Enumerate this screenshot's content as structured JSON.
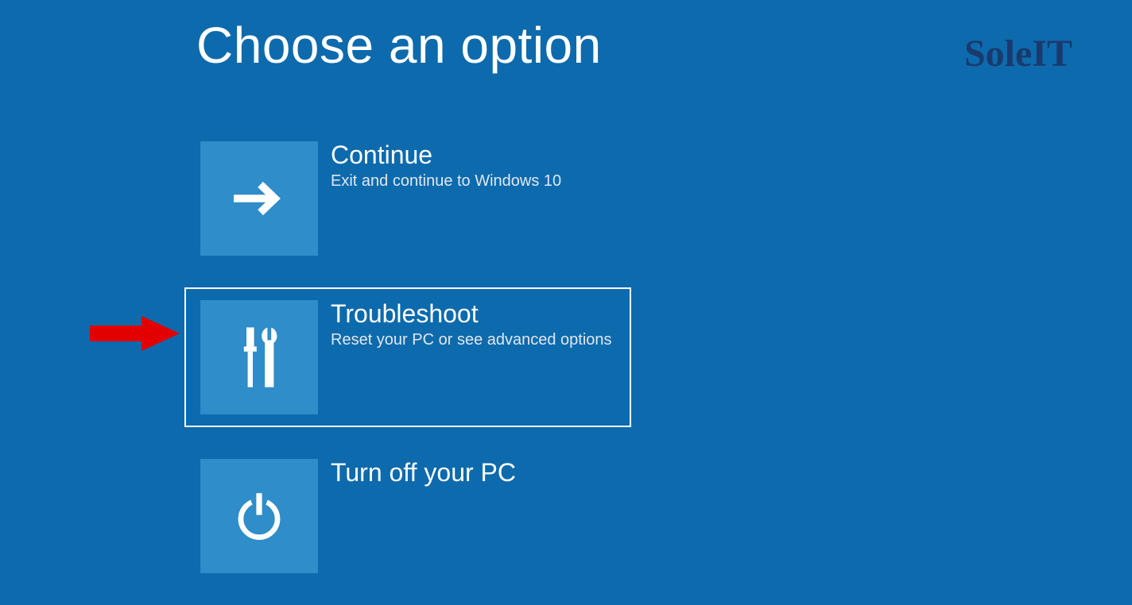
{
  "header": {
    "title": "Choose an option"
  },
  "watermark": "SoleIT",
  "options": [
    {
      "title": "Continue",
      "description": "Exit and continue to Windows 10",
      "icon": "arrow-right",
      "selected": false
    },
    {
      "title": "Troubleshoot",
      "description": "Reset your PC or see advanced options",
      "icon": "tools",
      "selected": true
    },
    {
      "title": "Turn off your PC",
      "description": "",
      "icon": "power",
      "selected": false
    }
  ],
  "annotation": {
    "points_to_index": 1
  }
}
